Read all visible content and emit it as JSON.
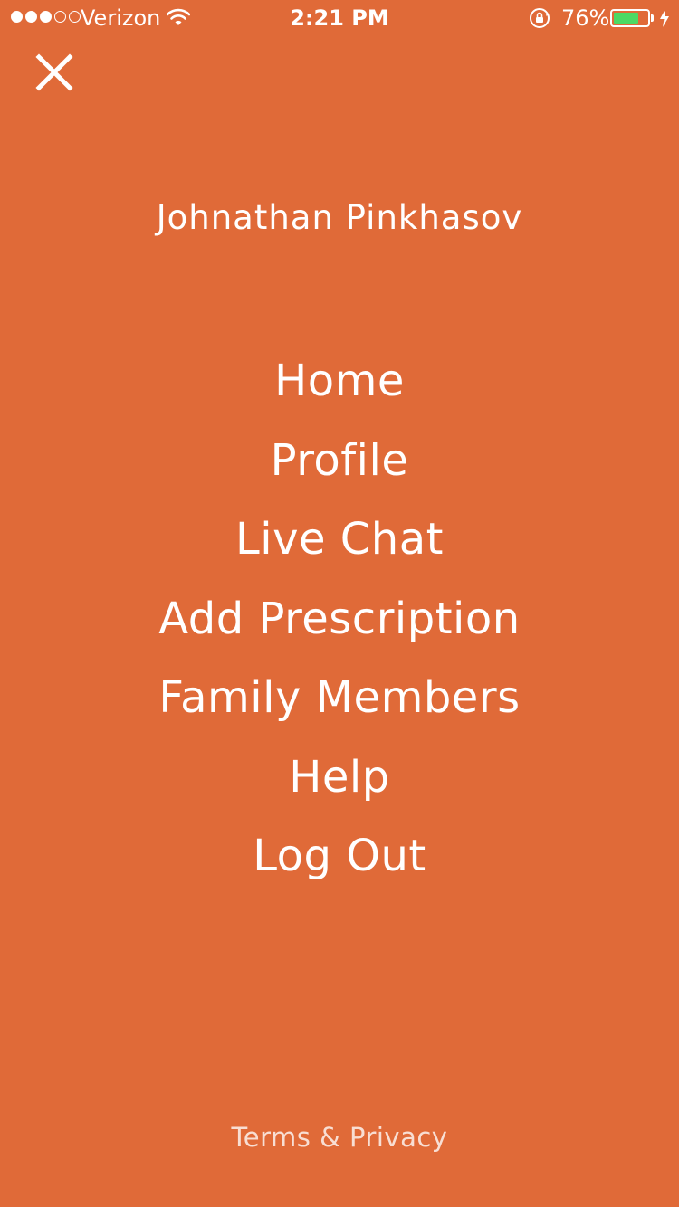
{
  "status_bar": {
    "carrier": "Verizon",
    "time": "2:21 PM",
    "battery_percent": "76%",
    "battery_level": 0.76,
    "signal_bars_filled": 3,
    "signal_bars_total": 5,
    "icons": [
      "signal-dots-icon",
      "wifi-icon",
      "rotation-lock-icon",
      "battery-icon",
      "charging-bolt-icon"
    ]
  },
  "colors": {
    "background": "#E06A38",
    "text": "#FFFFFF",
    "battery_fill": "#4CD964"
  },
  "header": {
    "close_icon": "close-icon",
    "user_name": "Johnathan Pinkhasov"
  },
  "menu": {
    "items": [
      {
        "label": "Home"
      },
      {
        "label": "Profile"
      },
      {
        "label": "Live Chat"
      },
      {
        "label": "Add Prescription"
      },
      {
        "label": "Family Members"
      },
      {
        "label": "Help"
      },
      {
        "label": "Log Out"
      }
    ]
  },
  "footer": {
    "link_label": "Terms & Privacy"
  }
}
